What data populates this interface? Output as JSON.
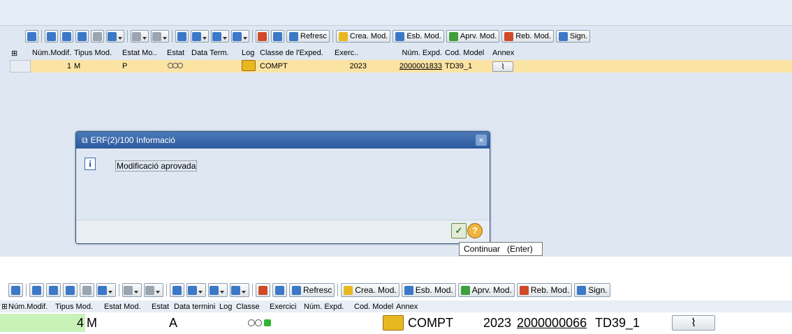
{
  "toolbar": {
    "refresh_label": "Refresc",
    "create_label": "Crea. Mod.",
    "delete_label": "Esb. Mod.",
    "approve_label": "Aprv. Mod.",
    "reject_label": "Reb. Mod.",
    "sign_label": "Sign."
  },
  "table1": {
    "headers": [
      "Núm.Modif.",
      "Tipus Mod.",
      "Estat Mo..",
      "Estat",
      "Data Term.",
      "Log",
      "Classe de l'Exped.",
      "Exerc..",
      "Núm. Expd.",
      "Cod. Model",
      "Annex"
    ],
    "row": {
      "num_modif": "1",
      "tipus": "M",
      "estat_mod": "P",
      "classe": "COMPT",
      "exercici": "2023",
      "num_expd": "2000001833",
      "cod_model": "TD39_1"
    }
  },
  "dialog": {
    "title": "ERF(2)/100 Informació",
    "message": "Modificació aprovada",
    "close_glyph": "×",
    "tooltip": "Continuar   (Enter)"
  },
  "table2": {
    "headers": [
      "Núm.Modif.",
      "Tipus Mod.",
      "Estat Mod.",
      "Estat",
      "Data termini",
      "Log",
      "Classe",
      "Exercici",
      "Núm. Expd.",
      "Cod. Model",
      "Annex"
    ],
    "row": {
      "num_modif": "4",
      "tipus": "M",
      "estat_mod": "A",
      "classe": "COMPT",
      "exercici": "2023",
      "num_expd": "2000000066",
      "cod_model": "TD39_1"
    }
  },
  "colors": {
    "selected_row": "#fbe3a4",
    "dialog_title": "#2c5aa0",
    "row2_highlight": "#c9f2b8"
  }
}
